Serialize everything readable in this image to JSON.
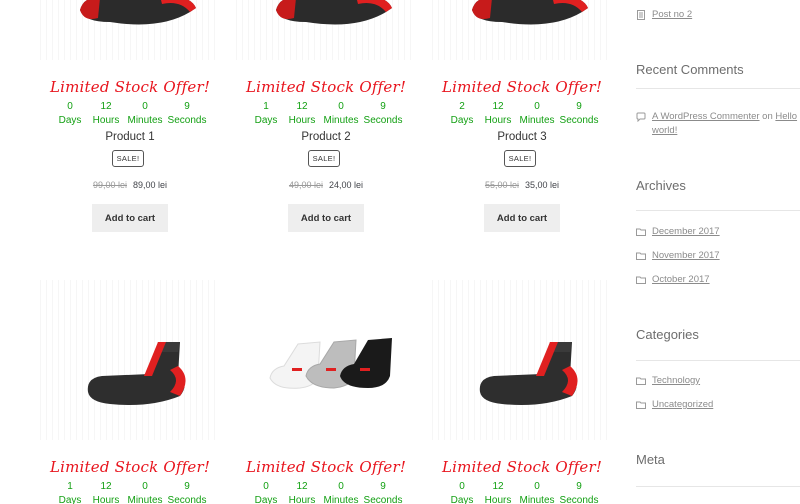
{
  "products": [
    {
      "offer": "Limited Stock Offer!",
      "countdown": {
        "days": "0",
        "hours": "12",
        "minutes": "0",
        "seconds": "9"
      },
      "title": "Product 1",
      "sale": "SALE!",
      "old_price": "99,00 lei",
      "price": "89,00 lei",
      "cart": "Add to cart"
    },
    {
      "offer": "Limited Stock Offer!",
      "countdown": {
        "days": "1",
        "hours": "12",
        "minutes": "0",
        "seconds": "9"
      },
      "title": "Product 2",
      "sale": "SALE!",
      "old_price": "49,00 lei",
      "price": "24,00 lei",
      "cart": "Add to cart"
    },
    {
      "offer": "Limited Stock Offer!",
      "countdown": {
        "days": "2",
        "hours": "12",
        "minutes": "0",
        "seconds": "9"
      },
      "title": "Product 3",
      "sale": "SALE!",
      "old_price": "55,00 lei",
      "price": "35,00 lei",
      "cart": "Add to cart"
    },
    {
      "offer": "Limited Stock Offer!",
      "countdown": {
        "days": "1",
        "hours": "12",
        "minutes": "0",
        "seconds": "9"
      }
    },
    {
      "offer": "Limited Stock Offer!",
      "countdown": {
        "days": "0",
        "hours": "12",
        "minutes": "0",
        "seconds": "9"
      }
    },
    {
      "offer": "Limited Stock Offer!",
      "countdown": {
        "days": "0",
        "hours": "12",
        "minutes": "0",
        "seconds": "9"
      }
    }
  ],
  "countdown_labels": {
    "days": "Days",
    "hours": "Hours",
    "minutes": "Minutes",
    "seconds": "Seconds"
  },
  "sidebar": {
    "recent_post": "Post no 2",
    "recent_comments": {
      "heading": "Recent Comments",
      "author": "A WordPress Commenter",
      "on": "on",
      "post": "Hello world!"
    },
    "archives": {
      "heading": "Archives",
      "items": [
        "December 2017",
        "November 2017",
        "October 2017"
      ]
    },
    "categories": {
      "heading": "Categories",
      "items": [
        "Technology",
        "Uncategorized"
      ]
    },
    "meta": {
      "heading": "Meta"
    }
  },
  "colors": {
    "offer": "#e8141d",
    "countdown": "#13a013",
    "link": "#8b8b8b"
  }
}
